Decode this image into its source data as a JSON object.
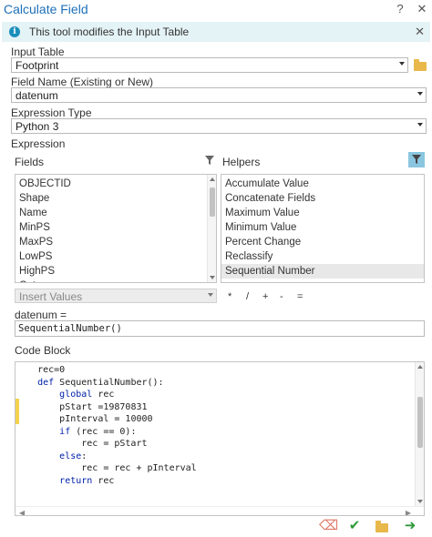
{
  "window": {
    "title": "Calculate Field",
    "help_glyph": "?",
    "close_glyph": "✕"
  },
  "infobar": {
    "icon_glyph": "i",
    "text": "This tool modifies the Input Table",
    "close_glyph": "✕"
  },
  "input_table": {
    "label": "Input Table",
    "value": "Footprint"
  },
  "field_name": {
    "label": "Field Name (Existing or New)",
    "value": "datenum"
  },
  "expression_type": {
    "label": "Expression Type",
    "value": "Python 3"
  },
  "expression": {
    "label": "Expression",
    "fields_label": "Fields",
    "helpers_label": "Helpers",
    "fields": [
      "OBJECTID",
      "Shape",
      "Name",
      "MinPS",
      "MaxPS",
      "LowPS",
      "HighPS",
      "Cat..."
    ],
    "helpers": [
      "Accumulate Value",
      "Concatenate Fields",
      "Maximum Value",
      "Minimum Value",
      "Percent Change",
      "Reclassify",
      "Sequential Number"
    ],
    "selected_helper": "Sequential Number",
    "insert_values_placeholder": "Insert Values",
    "operators": [
      "*",
      "/",
      "+",
      "-",
      "="
    ],
    "assign_label": "datenum =",
    "value": "SequentialNumber()"
  },
  "code_block": {
    "label": "Code Block",
    "lines": [
      [
        "    ",
        "",
        "rec=0"
      ],
      [
        "    ",
        "def",
        " SequentialNumber():"
      ],
      [
        "        ",
        "global",
        " rec"
      ],
      [
        "        ",
        "",
        "pStart =19870831"
      ],
      [
        "        ",
        "",
        "pInterval = 10000"
      ],
      [
        "        ",
        "if",
        " (rec == 0):"
      ],
      [
        "            ",
        "",
        "rec = pStart"
      ],
      [
        "        ",
        "else",
        ":"
      ],
      [
        "            ",
        "",
        "rec = rec + pInterval"
      ],
      [
        "        ",
        "return",
        " rec"
      ]
    ]
  },
  "colors": {
    "accent": "#1d6fb8",
    "info_bg": "#e4f3f6",
    "keyword": "#0020a8",
    "change_marker": "#f2d24b"
  },
  "footer": {
    "icons": [
      "eraser-icon",
      "check-icon",
      "folder-open-icon",
      "run-arrow-icon"
    ],
    "eraser_glyph": "⌫",
    "check_glyph": "✔",
    "run_glyph": "➜"
  }
}
